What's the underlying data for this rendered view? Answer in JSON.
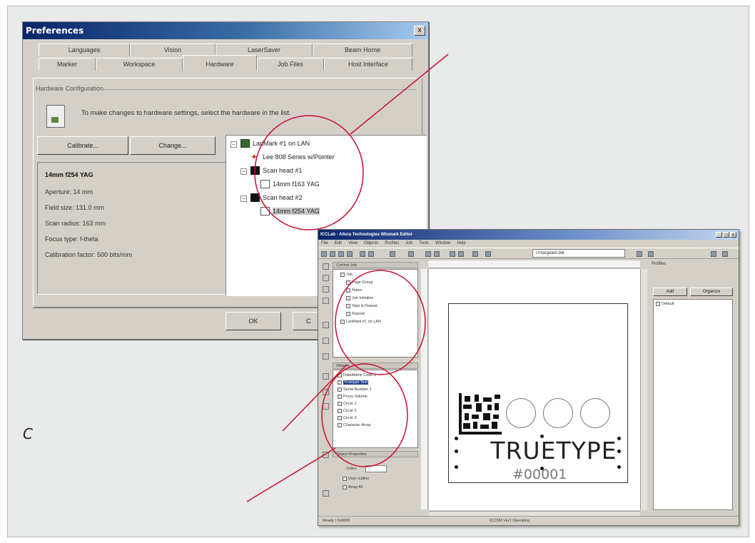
{
  "figure_label": "C",
  "preferences": {
    "title": "Preferences",
    "close_glyph": "x",
    "tabs_back": [
      "Languages",
      "Vision",
      "LaserSaver",
      "Beam Home"
    ],
    "tabs_front": [
      "Marker",
      "Workspace",
      "Hardware",
      "Job Files",
      "Host Interface"
    ],
    "active_tab": "Hardware",
    "group_title": "Hardware Configuration",
    "hint": "To make changes to hardware settings, select the hardware in the list.",
    "buttons": {
      "calibrate": "Calibrate...",
      "change": "Change...",
      "ok": "OK",
      "cancel": "C"
    },
    "info": {
      "heading": "14mm f254 YAG",
      "aperture": "Aperture: 14 mm",
      "field_size": "Field size: 131.0 mm",
      "scan_radius": "Scan radius: 163 mm",
      "focus_type": "Focus type: f-theta",
      "calibration": "Calibration factor: 500 bits/mm"
    },
    "tree": {
      "root": "LanMark #1 on LAN",
      "laser": "Lee 808 Series w/Pointer",
      "scan1": "Scan head #1",
      "lens1": "14mm f163 YAG",
      "scan2": "Scan head #2",
      "lens2": "14mm f254 YAG"
    },
    "icon": "hardware-icon"
  },
  "editor": {
    "title": "ICCLab - Allura Technologies Winmark Editor",
    "window_controls": [
      "_",
      "□",
      "x"
    ],
    "menu": [
      "File",
      "Edit",
      "View",
      "Objects",
      "Profiles",
      "Job",
      "Tools",
      "Window",
      "Help"
    ],
    "layer_combo": "Untargeted.dat",
    "tree_header": "Current Job",
    "tree_items": [
      "Job",
      "Page Group",
      "Notes",
      "Job Initialize",
      "Step & Repeat",
      "Repeat",
      "LanMark #1 on LAN"
    ],
    "objects_header": "Objects",
    "object_items": [
      "DataMatrix Code 1",
      "Truetype Text",
      "Serial Number 1",
      "Proxy Volume",
      "Circle 1",
      "Circle 2",
      "Circle 3",
      "Character Array"
    ],
    "props_header": "Object Properties",
    "props": {
      "index_label": "Index",
      "user_outline": "User outline",
      "array_fill": "Array fill"
    },
    "canvas_text": "TRUETYPE",
    "serial_text": "#00001",
    "right_panel": {
      "header": "Profiles",
      "btn_add": "Add",
      "btn_organize": "Organize",
      "item": "Default"
    },
    "status": [
      "Ready | 0x0000",
      "ICCSM Ver1 Operating"
    ]
  },
  "colors": {
    "callout": "#c8102e",
    "titlebar": "#0a246a"
  }
}
